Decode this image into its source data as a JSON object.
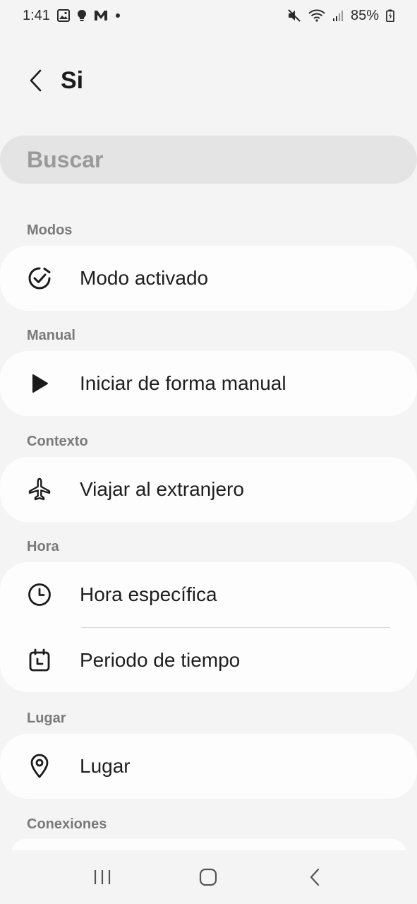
{
  "status_bar": {
    "time": "1:41",
    "battery": "85%",
    "left_icons": [
      "gallery-icon",
      "bulb-icon",
      "m-app-icon",
      "dot-icon"
    ],
    "right_icons": [
      "mute-icon",
      "wifi-icon",
      "signal-icon",
      "battery-icon"
    ]
  },
  "header": {
    "title": "Si"
  },
  "search": {
    "placeholder": "Buscar"
  },
  "sections": {
    "modos": "Modos",
    "manual": "Manual",
    "contexto": "Contexto",
    "hora": "Hora",
    "lugar": "Lugar",
    "conexiones": "Conexiones"
  },
  "items": {
    "modo_activado": "Modo activado",
    "iniciar_manual": "Iniciar de forma manual",
    "viajar": "Viajar al extranjero",
    "hora_especifica": "Hora específica",
    "periodo": "Periodo de tiempo",
    "lugar": "Lugar"
  },
  "colors": {
    "background": "#f4f4f4",
    "card": "#fdfdfd",
    "search": "#e4e4e4",
    "section_label": "#7a7a7a"
  }
}
